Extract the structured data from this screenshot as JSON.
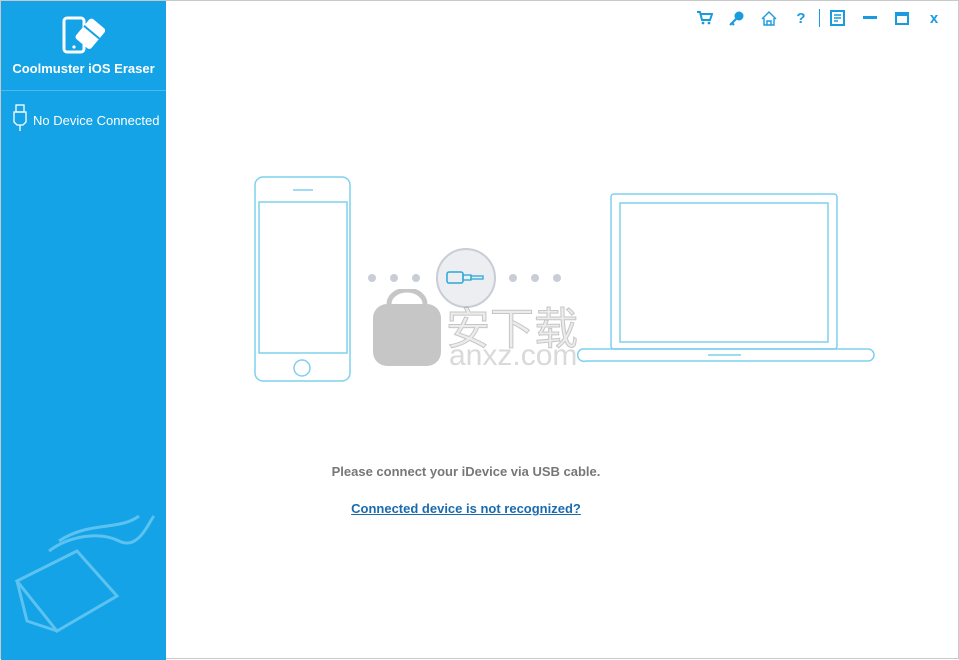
{
  "app": {
    "title": "Coolmuster iOS Eraser"
  },
  "sidebar": {
    "device_status": "No Device Connected"
  },
  "toolbar": {
    "icons": [
      "cart-icon",
      "key-icon",
      "home-icon",
      "help-icon",
      "feedback-icon",
      "minimize-icon",
      "maximize-icon",
      "close-icon"
    ],
    "help_label": "?",
    "close_label": "x"
  },
  "main": {
    "message": "Please connect your iDevice via USB cable.",
    "help_link": "Connected device is not recognized?"
  },
  "watermark": {
    "text": "安下载",
    "domain": "anxz.com"
  },
  "colors": {
    "sidebar": "#13a3e6",
    "accent": "#1a9be0",
    "link": "#1a6bad"
  }
}
